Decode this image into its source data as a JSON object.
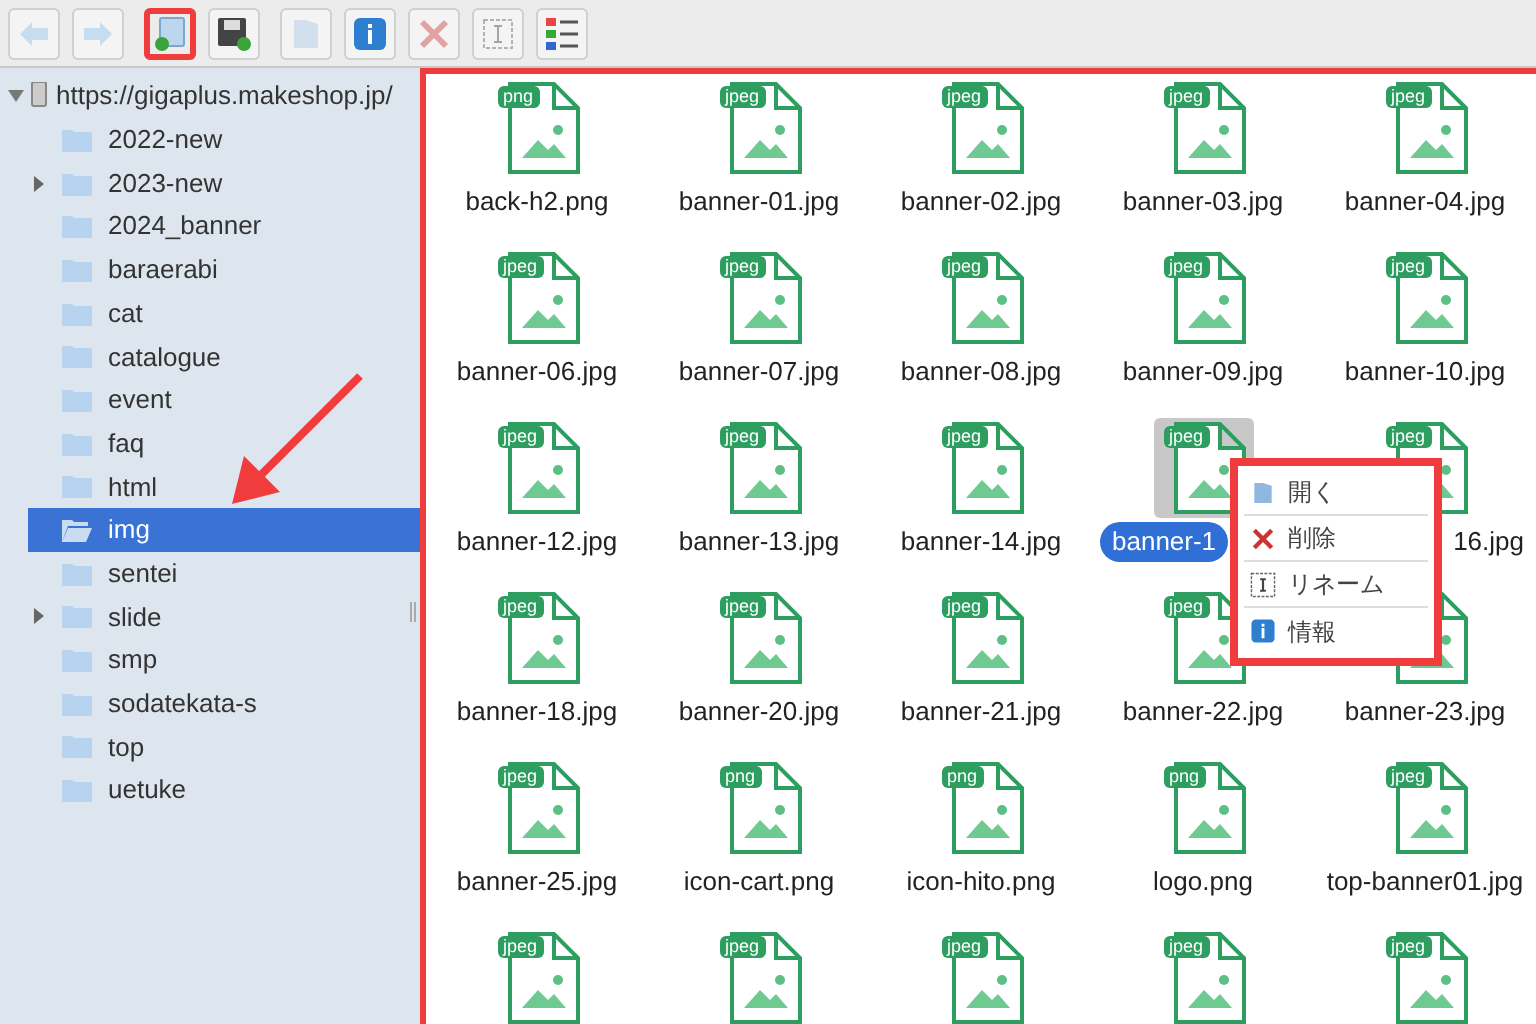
{
  "toolbar": {
    "buttons": [
      {
        "kind": "back",
        "disabled": true,
        "highlighted": false
      },
      {
        "kind": "forward",
        "disabled": true,
        "highlighted": false
      },
      {
        "kind": "upload",
        "disabled": false,
        "highlighted": true
      },
      {
        "kind": "save",
        "disabled": false,
        "highlighted": false
      },
      {
        "kind": "open",
        "disabled": true,
        "highlighted": false
      },
      {
        "kind": "info",
        "disabled": false,
        "highlighted": false
      },
      {
        "kind": "delete",
        "disabled": true,
        "highlighted": false
      },
      {
        "kind": "rename",
        "disabled": true,
        "highlighted": false
      },
      {
        "kind": "view",
        "disabled": false,
        "highlighted": false
      }
    ]
  },
  "tree": {
    "label": "https://gigaplus.makeshop.jp/",
    "expanded": true,
    "children": [
      {
        "label": "2022-new",
        "has_children": false,
        "selected": false
      },
      {
        "label": "2023-new",
        "has_children": true,
        "selected": false
      },
      {
        "label": "2024_banner",
        "has_children": false,
        "selected": false
      },
      {
        "label": "baraerabi",
        "has_children": false,
        "selected": false
      },
      {
        "label": "cat",
        "has_children": false,
        "selected": false
      },
      {
        "label": "catalogue",
        "has_children": false,
        "selected": false
      },
      {
        "label": "event",
        "has_children": false,
        "selected": false
      },
      {
        "label": "faq",
        "has_children": false,
        "selected": false
      },
      {
        "label": "html",
        "has_children": false,
        "selected": false
      },
      {
        "label": "img",
        "has_children": false,
        "selected": true
      },
      {
        "label": "sentei",
        "has_children": false,
        "selected": false
      },
      {
        "label": "slide",
        "has_children": true,
        "selected": false
      },
      {
        "label": "smp",
        "has_children": false,
        "selected": false
      },
      {
        "label": "sodatekata-s",
        "has_children": false,
        "selected": false
      },
      {
        "label": "top",
        "has_children": false,
        "selected": false
      },
      {
        "label": "uetuke",
        "has_children": false,
        "selected": false
      }
    ]
  },
  "files": [
    {
      "badge": "png",
      "name": "back-h2.png",
      "selected": false
    },
    {
      "badge": "jpeg",
      "name": "banner-01.jpg",
      "selected": false
    },
    {
      "badge": "jpeg",
      "name": "banner-02.jpg",
      "selected": false
    },
    {
      "badge": "jpeg",
      "name": "banner-03.jpg",
      "selected": false
    },
    {
      "badge": "jpeg",
      "name": "banner-04.jpg",
      "selected": false
    },
    {
      "badge": "jpeg",
      "name": "banner-06.jpg",
      "selected": false
    },
    {
      "badge": "jpeg",
      "name": "banner-07.jpg",
      "selected": false
    },
    {
      "badge": "jpeg",
      "name": "banner-08.jpg",
      "selected": false
    },
    {
      "badge": "jpeg",
      "name": "banner-09.jpg",
      "selected": false
    },
    {
      "badge": "jpeg",
      "name": "banner-10.jpg",
      "selected": false
    },
    {
      "badge": "jpeg",
      "name": "banner-12.jpg",
      "selected": false
    },
    {
      "badge": "jpeg",
      "name": "banner-13.jpg",
      "selected": false
    },
    {
      "badge": "jpeg",
      "name": "banner-14.jpg",
      "selected": false
    },
    {
      "badge": "jpeg",
      "name": "banner-1",
      "selected": true,
      "covered_right": true
    },
    {
      "badge": "jpeg",
      "name": "16.jpg",
      "selected": false,
      "covered_left": true
    },
    {
      "badge": "jpeg",
      "name": "banner-18.jpg",
      "selected": false
    },
    {
      "badge": "jpeg",
      "name": "banner-20.jpg",
      "selected": false
    },
    {
      "badge": "jpeg",
      "name": "banner-21.jpg",
      "selected": false
    },
    {
      "badge": "jpeg",
      "name": "banner-22.jpg",
      "selected": false
    },
    {
      "name": "banner-23.jpg",
      "selected": false
    },
    {
      "badge": "jpeg",
      "name": "banner-25.jpg",
      "selected": false
    },
    {
      "badge": "png",
      "name": "icon-cart.png",
      "selected": false
    },
    {
      "badge": "png",
      "name": "icon-hito.png",
      "selected": false
    },
    {
      "badge": "png",
      "name": "logo.png",
      "selected": false
    },
    {
      "badge": "jpeg",
      "name": "top-banner01.jpg",
      "selected": false
    },
    {
      "badge": "jpeg",
      "selected": false
    },
    {
      "badge": "jpeg",
      "selected": false
    },
    {
      "badge": "jpeg",
      "selected": false
    },
    {
      "badge": "jpeg",
      "selected": false
    },
    {
      "badge": "jpeg",
      "selected": false
    }
  ],
  "context_menu": {
    "items": [
      {
        "kind": "open",
        "label": "開く"
      },
      {
        "kind": "delete",
        "label": "削除"
      },
      {
        "kind": "rename",
        "label": "リネーム"
      },
      {
        "kind": "info",
        "label": "情報"
      }
    ]
  }
}
